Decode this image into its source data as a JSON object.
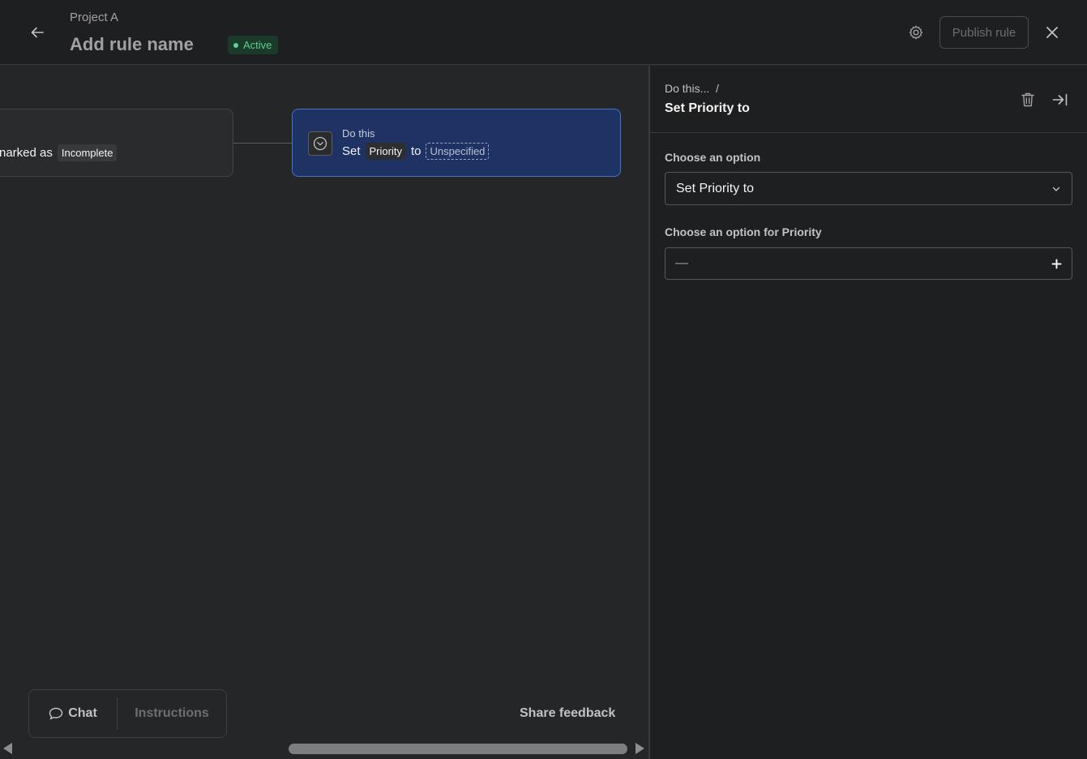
{
  "header": {
    "project": "Project A",
    "rule_name": "Add rule name",
    "status": "Active",
    "publish_label": "Publish rule",
    "icons": {
      "back": "arrow-left-icon",
      "settings": "gear-icon",
      "close": "close-icon"
    }
  },
  "canvas": {
    "trigger": {
      "text": "narked as",
      "chip": "Incomplete"
    },
    "action": {
      "eyebrow": "Do this",
      "verb": "Set",
      "field": "Priority",
      "connector": "to",
      "value": "Unspecified"
    },
    "toolbar": {
      "chat": "Chat",
      "instructions": "Instructions"
    },
    "share_feedback": "Share feedback"
  },
  "panel": {
    "breadcrumb": "Do this...  /",
    "title": "Set Priority to",
    "field1_label": "Choose an option",
    "field1_value": "Set Priority to",
    "field2_label": "Choose an option for Priority",
    "field2_value": "—"
  },
  "colors": {
    "accent": "#4573d2",
    "status_green": "#5fcf92"
  }
}
